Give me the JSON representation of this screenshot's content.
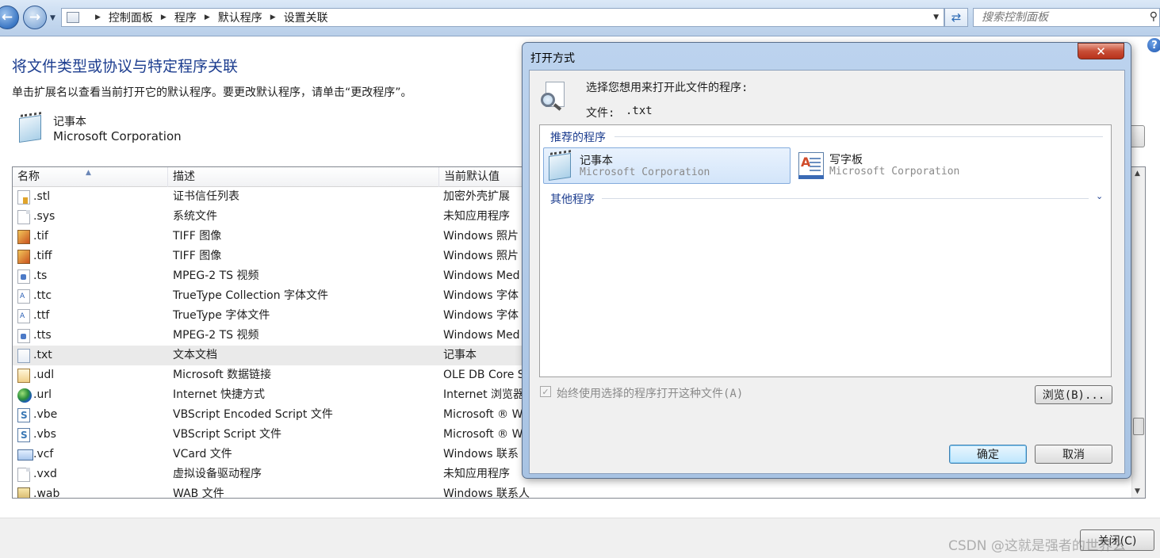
{
  "address_bar": {
    "breadcrumbs": [
      "控制面板",
      "程序",
      "默认程序",
      "设置关联"
    ],
    "search_placeholder": "搜索控制面板"
  },
  "main": {
    "title": "将文件类型或协议与特定程序关联",
    "description": "单击扩展名以查看当前打开它的默认程序。要更改默认程序，请单击“更改程序”。",
    "selected_app": {
      "name": "记事本",
      "company": "Microsoft Corporation"
    },
    "columns": [
      "名称",
      "描述",
      "当前默认值"
    ],
    "rows": [
      {
        "ext": ".stl",
        "desc": "证书信任列表",
        "default": "加密外壳扩展",
        "icon": "certificate-file-icon"
      },
      {
        "ext": ".sys",
        "desc": "系统文件",
        "default": "未知应用程序",
        "icon": "blank-file-icon"
      },
      {
        "ext": ".tif",
        "desc": "TIFF 图像",
        "default": "Windows 照片",
        "icon": "image-file-icon"
      },
      {
        "ext": ".tiff",
        "desc": "TIFF 图像",
        "default": "Windows 照片",
        "icon": "image-file-icon"
      },
      {
        "ext": ".ts",
        "desc": "MPEG-2 TS 视频",
        "default": "Windows Med",
        "icon": "media-file-icon"
      },
      {
        "ext": ".ttc",
        "desc": "TrueType Collection 字体文件",
        "default": "Windows 字体",
        "icon": "font-file-icon"
      },
      {
        "ext": ".ttf",
        "desc": "TrueType 字体文件",
        "default": "Windows 字体",
        "icon": "font-file-icon"
      },
      {
        "ext": ".tts",
        "desc": "MPEG-2 TS 视频",
        "default": "Windows Med",
        "icon": "media-file-icon"
      },
      {
        "ext": ".txt",
        "desc": "文本文档",
        "default": "记事本",
        "icon": "text-file-icon",
        "selected": true
      },
      {
        "ext": ".udl",
        "desc": "Microsoft 数据链接",
        "default": "OLE DB Core S",
        "icon": "data-link-file-icon"
      },
      {
        "ext": ".url",
        "desc": "Internet 快捷方式",
        "default": "Internet 浏览器",
        "icon": "globe-icon"
      },
      {
        "ext": ".vbe",
        "desc": "VBScript Encoded Script 文件",
        "default": "Microsoft ® W",
        "icon": "script-file-icon"
      },
      {
        "ext": ".vbs",
        "desc": "VBScript Script 文件",
        "default": "Microsoft ® W",
        "icon": "script-file-icon"
      },
      {
        "ext": ".vcf",
        "desc": "VCard 文件",
        "default": "Windows 联系",
        "icon": "vcard-file-icon"
      },
      {
        "ext": ".vxd",
        "desc": "虚拟设备驱动程序",
        "default": "未知应用程序",
        "icon": "blank-file-icon"
      },
      {
        "ext": ".wab",
        "desc": "WAB 文件",
        "default": "Windows 联系人",
        "icon": "address-book-file-icon"
      }
    ],
    "close_button": "关闭(C)"
  },
  "dialog": {
    "title": "打开方式",
    "prompt": "选择您想用来打开此文件的程序:",
    "file_label": "文件:",
    "file_value": ".txt",
    "recommended_label": "推荐的程序",
    "other_label": "其他程序",
    "programs": [
      {
        "name": "记事本",
        "company": "Microsoft Corporation"
      },
      {
        "name": "写字板",
        "company": "Microsoft Corporation"
      }
    ],
    "always_use_label": "始终使用选择的程序打开这种文件(A)",
    "browse_button": "浏览(B)...",
    "ok_button": "确定",
    "cancel_button": "取消"
  },
  "watermark": "CSDN @这就是强者的世界么"
}
